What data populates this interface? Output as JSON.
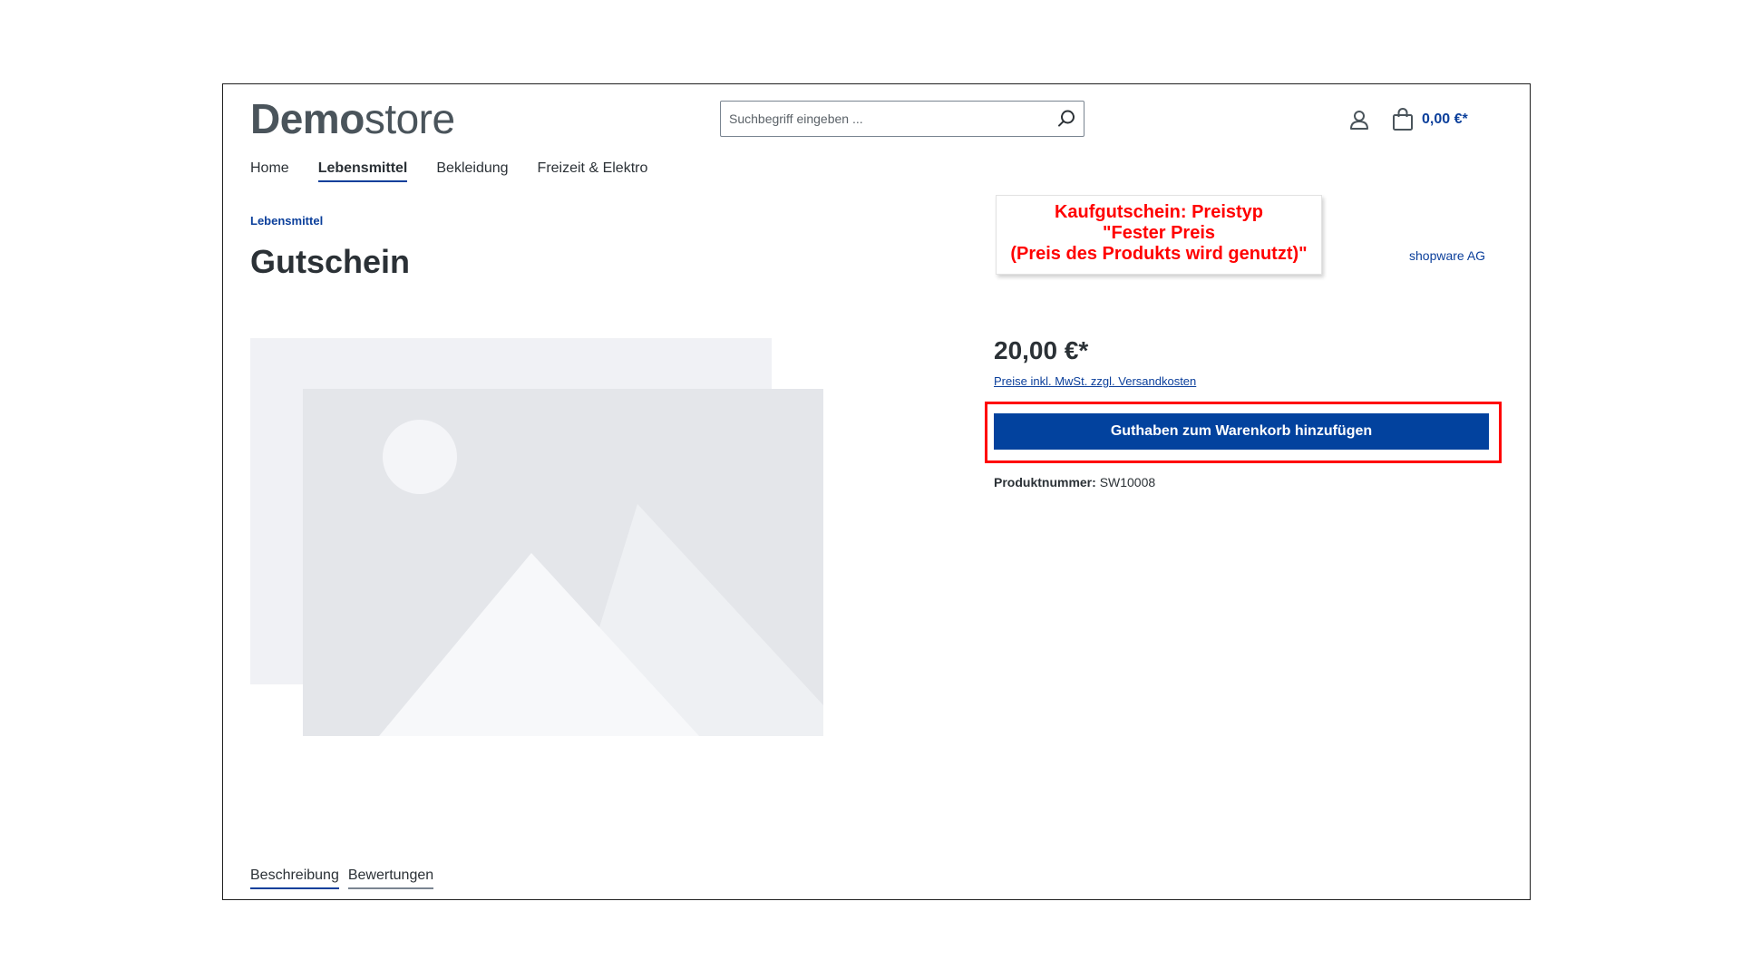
{
  "header": {
    "logo_bold": "Demo",
    "logo_light": "store",
    "search_placeholder": "Suchbegriff eingeben ...",
    "search_icon": "search-icon",
    "account_icon": "user-icon",
    "cart_icon": "shopping-bag-icon",
    "cart_total": "0,00 €*"
  },
  "nav": {
    "items": [
      {
        "label": "Home"
      },
      {
        "label": "Lebensmittel"
      },
      {
        "label": "Bekleidung"
      },
      {
        "label": "Freizeit & Elektro"
      }
    ],
    "active_index": 1
  },
  "breadcrumb": "Lebensmittel",
  "product": {
    "title": "Gutschein",
    "manufacturer": "shopware AG",
    "price": "20,00 €*",
    "tax_note": "Preise inkl. MwSt. zzgl. Versandkosten",
    "buy_button": "Guthaben zum Warenkorb hinzufügen",
    "number_label": "Produktnummer:",
    "number_value": "SW10008",
    "image": "image-placeholder-icon"
  },
  "annotation": {
    "lines": [
      "Kaufgutschein: Preistyp",
      "\"Fester Preis",
      "(Preis des Produkts wird genutzt)\""
    ],
    "color": "#ff0000"
  },
  "tabs": [
    {
      "label": "Beschreibung"
    },
    {
      "label": "Bewertungen"
    }
  ],
  "colors": {
    "brand": "#0b3f9b",
    "button": "#02429e",
    "highlight": "#ff0000"
  }
}
